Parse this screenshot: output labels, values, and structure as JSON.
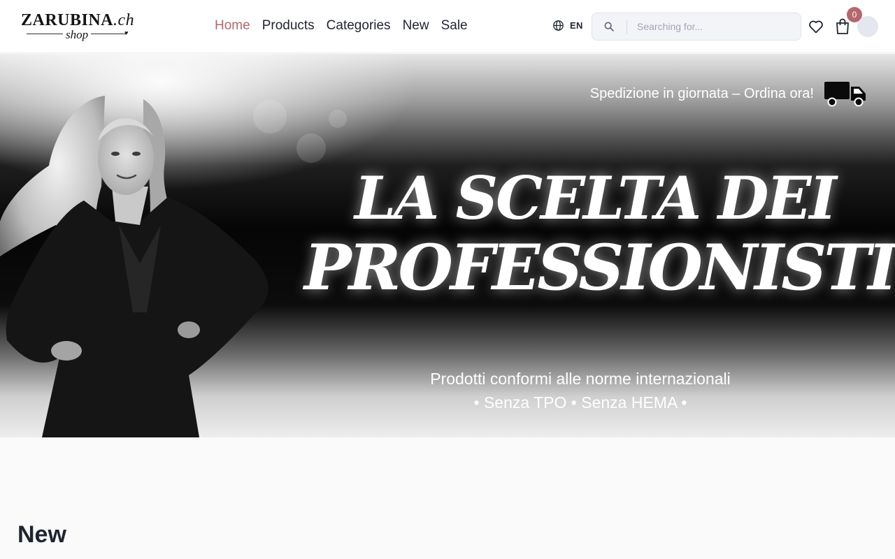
{
  "header": {
    "logo": {
      "main": "ZARUBINA",
      "ext": ".ch",
      "sub": "shop"
    },
    "nav": [
      {
        "label": "Home",
        "active": true
      },
      {
        "label": "Products",
        "active": false
      },
      {
        "label": "Categories",
        "active": false
      },
      {
        "label": "New",
        "active": false
      },
      {
        "label": "Sale",
        "active": false
      }
    ],
    "language": {
      "label": "EN",
      "icon": "globe-icon"
    },
    "search": {
      "placeholder": "Searching for...",
      "value": "",
      "icon": "search-icon"
    },
    "wishlist_icon": "heart-icon",
    "cart": {
      "icon": "shopping-bag-icon",
      "count": "0"
    },
    "avatar_icon": "user-avatar"
  },
  "hero": {
    "shipping_text": "Spedizione in giornata – Ordina ora!",
    "shipping_icon": "truck-icon",
    "headline_line1": "LA SCELTA DEI",
    "headline_line2": "PROFESSIONISTI",
    "subline1": "Prodotti conformi alle norme internazionali",
    "subline2": "• Senza TPO • Senza HEMA •"
  },
  "sections": {
    "new_title": "New"
  },
  "colors": {
    "accent": "#b5676d",
    "text": "#1f2430",
    "search_bg": "#f3f4f8",
    "page_bg": "#fafafa"
  }
}
